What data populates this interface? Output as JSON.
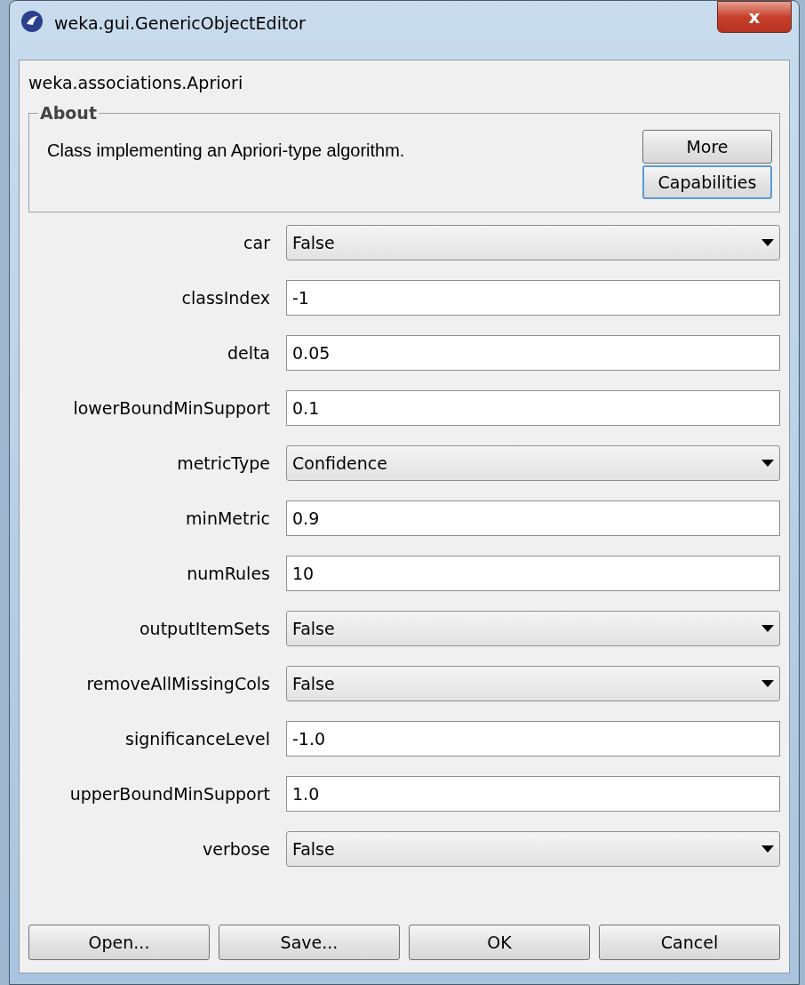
{
  "window": {
    "title": "weka.gui.GenericObjectEditor",
    "close_label": "x"
  },
  "class_name": "weka.associations.Apriori",
  "about": {
    "title": "About",
    "text": "Class implementing an Apriori-type algorithm.",
    "buttons": [
      {
        "label": "More",
        "focused": false
      },
      {
        "label": "Capabilities",
        "focused": true
      }
    ]
  },
  "properties": [
    {
      "label": "car",
      "kind": "dropdown",
      "value": "False"
    },
    {
      "label": "classIndex",
      "kind": "text",
      "value": "-1"
    },
    {
      "label": "delta",
      "kind": "text",
      "value": "0.05"
    },
    {
      "label": "lowerBoundMinSupport",
      "kind": "text",
      "value": "0.1"
    },
    {
      "label": "metricType",
      "kind": "dropdown",
      "value": "Confidence"
    },
    {
      "label": "minMetric",
      "kind": "text",
      "value": "0.9"
    },
    {
      "label": "numRules",
      "kind": "text",
      "value": "10"
    },
    {
      "label": "outputItemSets",
      "kind": "dropdown",
      "value": "False"
    },
    {
      "label": "removeAllMissingCols",
      "kind": "dropdown",
      "value": "False"
    },
    {
      "label": "significanceLevel",
      "kind": "text",
      "value": "-1.0"
    },
    {
      "label": "upperBoundMinSupport",
      "kind": "text",
      "value": "1.0"
    },
    {
      "label": "verbose",
      "kind": "dropdown",
      "value": "False"
    }
  ],
  "buttons": [
    "Open...",
    "Save...",
    "OK",
    "Cancel"
  ]
}
